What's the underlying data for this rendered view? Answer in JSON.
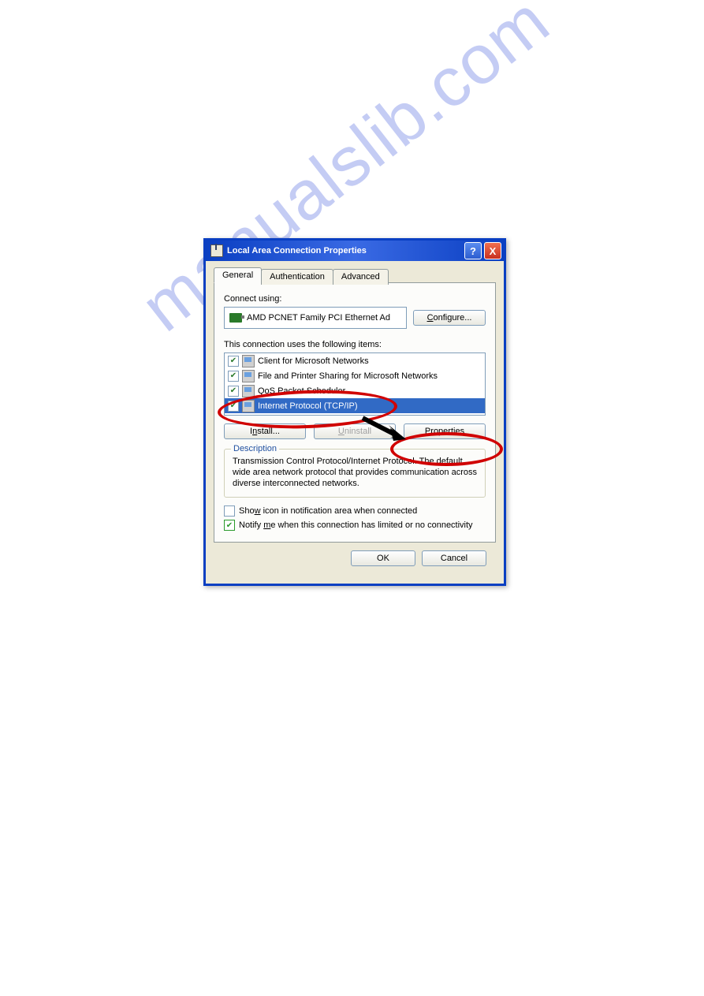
{
  "watermark": "manualslib.com",
  "titlebar": {
    "title": "Local Area Connection Properties",
    "help": "?",
    "close": "X"
  },
  "tabs": {
    "general": "General",
    "authentication": "Authentication",
    "advanced": "Advanced"
  },
  "general": {
    "connect_using_label": "Connect using:",
    "adapter": "AMD PCNET Family PCI Ethernet Ad",
    "configure_btn": "Configure...",
    "items_label": "This connection uses the following items:",
    "items": [
      {
        "checked": true,
        "label": "Client for Microsoft Networks"
      },
      {
        "checked": true,
        "label": "File and Printer Sharing for Microsoft Networks"
      },
      {
        "checked": true,
        "label": "QoS Packet Scheduler"
      },
      {
        "checked": true,
        "label": "Internet Protocol (TCP/IP)",
        "selected": true
      }
    ],
    "install_btn": "Install...",
    "uninstall_btn": "Uninstall",
    "properties_btn": "Properties",
    "description_legend": "Description",
    "description_text": "Transmission Control Protocol/Internet Protocol. The default wide area network protocol that provides communication across diverse interconnected networks.",
    "show_icon_prefix": "Sho",
    "show_icon_u": "w",
    "show_icon_suffix": " icon in notification area when connected",
    "notify_prefix": "Notify ",
    "notify_u": "m",
    "notify_suffix": "e when this connection has limited or no connectivity"
  },
  "footer": {
    "ok": "OK",
    "cancel": "Cancel"
  }
}
